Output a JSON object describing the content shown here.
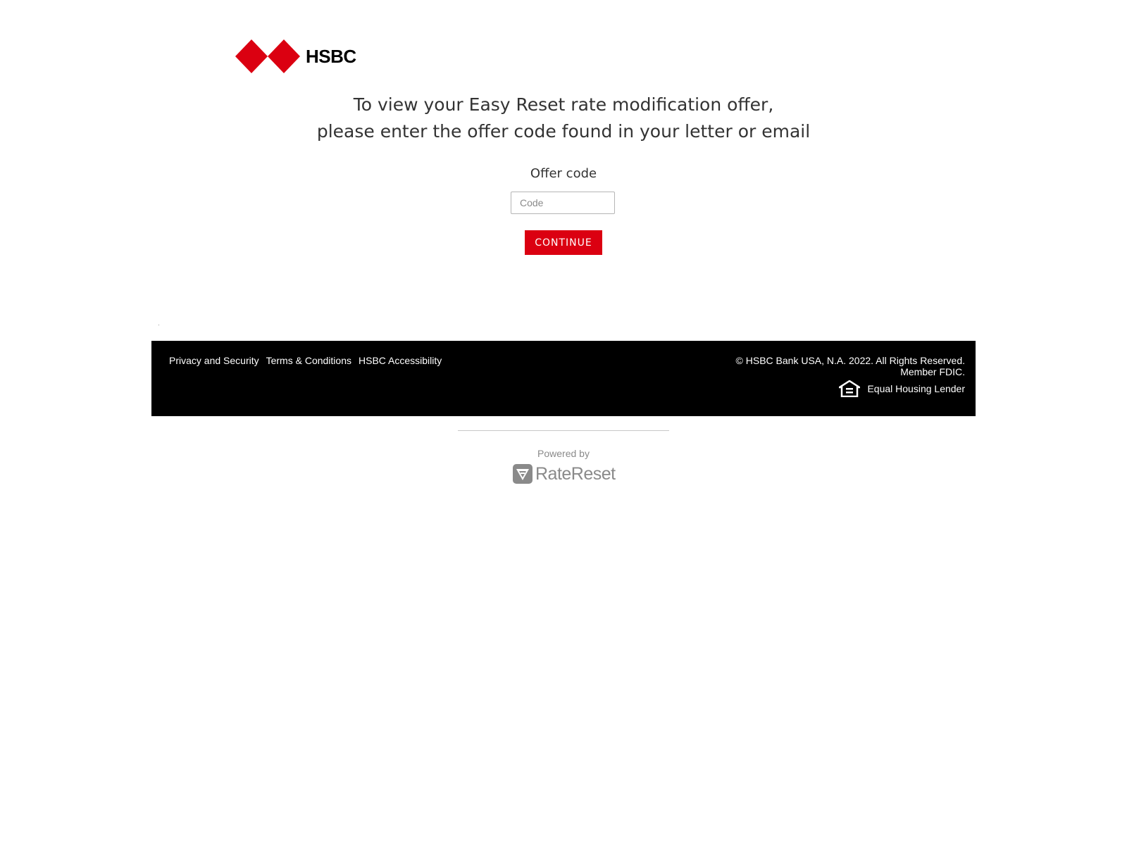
{
  "brand": {
    "name": "HSBC",
    "red": "#db0011",
    "logo_icon": "hsbc-hexagon-logo-icon"
  },
  "headline": {
    "line1": "To view your Easy Reset rate modification offer,",
    "line2": "please enter the offer code found in your letter or email"
  },
  "form": {
    "label": "Offer code",
    "input_placeholder": "Code",
    "input_value": "",
    "submit_label": "CONTINUE"
  },
  "footer": {
    "links": [
      "Privacy and Security",
      "Terms & Conditions",
      "HSBC Accessibility"
    ],
    "copyright": "© HSBC Bank USA, N.A. 2022. All Rights Reserved.",
    "member": "Member FDIC.",
    "equal_housing": "Equal Housing Lender",
    "equal_housing_icon": "equal-housing-icon"
  },
  "powered": {
    "label": "Powered by",
    "brand": "RateReset",
    "icon": "ratereset-logo-icon"
  }
}
